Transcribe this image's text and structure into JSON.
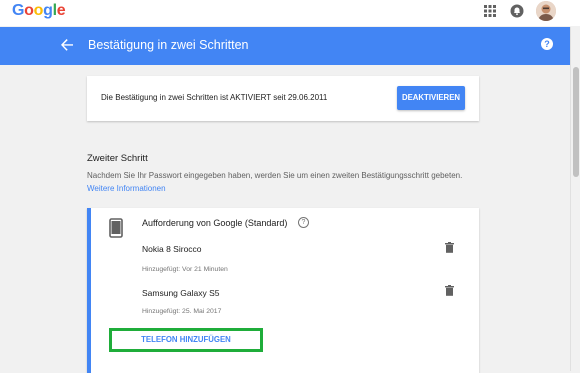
{
  "header": {
    "logo_letters": [
      "G",
      "o",
      "o",
      "g",
      "l",
      "e"
    ],
    "apps_icon": "apps-grid-icon",
    "notifications_icon": "bell-icon",
    "avatar": "user-avatar"
  },
  "page_bar": {
    "back_icon": "arrow-back-icon",
    "title": "Bestätigung in zwei Schritten",
    "help_icon_glyph": "?",
    "color": "#4285f4"
  },
  "status_card": {
    "text": "Die Bestätigung in zwei Schritten ist AKTIVIERT seit 29.06.2011",
    "deactivate_label": "DEAKTIVIEREN"
  },
  "second_step": {
    "title": "Zweiter Schritt",
    "description": "Nachdem Sie Ihr Passwort eingegeben haben, werden Sie um einen zweiten Bestätigungsschritt gebeten.",
    "more_info_link": "Weitere Informationen"
  },
  "method_card": {
    "icon": "smartphone-icon",
    "title": "Aufforderung von Google (Standard)",
    "info_glyph": "?",
    "devices": [
      {
        "name": "Nokia 8 Sirocco",
        "added": "Hinzugefügt: Vor 21 Minuten"
      },
      {
        "name": "Samsung Galaxy S5",
        "added": "Hinzugefügt: 25. Mai 2017"
      }
    ],
    "add_phone_label": "TELEFON HINZUFÜGEN",
    "highlight_color": "#1fad3a"
  }
}
